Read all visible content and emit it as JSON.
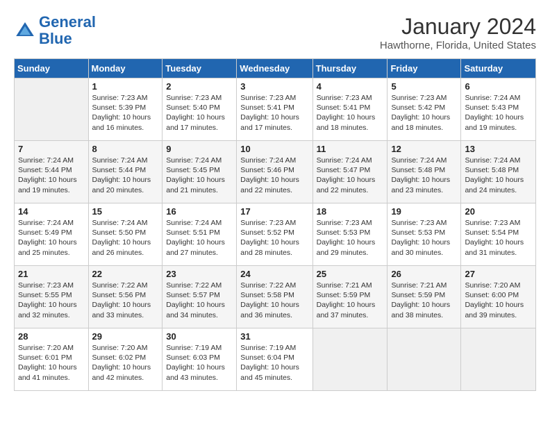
{
  "logo": {
    "line1": "General",
    "line2": "Blue"
  },
  "title": "January 2024",
  "subtitle": "Hawthorne, Florida, United States",
  "weekdays": [
    "Sunday",
    "Monday",
    "Tuesday",
    "Wednesday",
    "Thursday",
    "Friday",
    "Saturday"
  ],
  "weeks": [
    [
      {
        "num": "",
        "info": ""
      },
      {
        "num": "1",
        "info": "Sunrise: 7:23 AM\nSunset: 5:39 PM\nDaylight: 10 hours\nand 16 minutes."
      },
      {
        "num": "2",
        "info": "Sunrise: 7:23 AM\nSunset: 5:40 PM\nDaylight: 10 hours\nand 17 minutes."
      },
      {
        "num": "3",
        "info": "Sunrise: 7:23 AM\nSunset: 5:41 PM\nDaylight: 10 hours\nand 17 minutes."
      },
      {
        "num": "4",
        "info": "Sunrise: 7:23 AM\nSunset: 5:41 PM\nDaylight: 10 hours\nand 18 minutes."
      },
      {
        "num": "5",
        "info": "Sunrise: 7:23 AM\nSunset: 5:42 PM\nDaylight: 10 hours\nand 18 minutes."
      },
      {
        "num": "6",
        "info": "Sunrise: 7:24 AM\nSunset: 5:43 PM\nDaylight: 10 hours\nand 19 minutes."
      }
    ],
    [
      {
        "num": "7",
        "info": "Sunrise: 7:24 AM\nSunset: 5:44 PM\nDaylight: 10 hours\nand 19 minutes."
      },
      {
        "num": "8",
        "info": "Sunrise: 7:24 AM\nSunset: 5:44 PM\nDaylight: 10 hours\nand 20 minutes."
      },
      {
        "num": "9",
        "info": "Sunrise: 7:24 AM\nSunset: 5:45 PM\nDaylight: 10 hours\nand 21 minutes."
      },
      {
        "num": "10",
        "info": "Sunrise: 7:24 AM\nSunset: 5:46 PM\nDaylight: 10 hours\nand 22 minutes."
      },
      {
        "num": "11",
        "info": "Sunrise: 7:24 AM\nSunset: 5:47 PM\nDaylight: 10 hours\nand 22 minutes."
      },
      {
        "num": "12",
        "info": "Sunrise: 7:24 AM\nSunset: 5:48 PM\nDaylight: 10 hours\nand 23 minutes."
      },
      {
        "num": "13",
        "info": "Sunrise: 7:24 AM\nSunset: 5:48 PM\nDaylight: 10 hours\nand 24 minutes."
      }
    ],
    [
      {
        "num": "14",
        "info": "Sunrise: 7:24 AM\nSunset: 5:49 PM\nDaylight: 10 hours\nand 25 minutes."
      },
      {
        "num": "15",
        "info": "Sunrise: 7:24 AM\nSunset: 5:50 PM\nDaylight: 10 hours\nand 26 minutes."
      },
      {
        "num": "16",
        "info": "Sunrise: 7:24 AM\nSunset: 5:51 PM\nDaylight: 10 hours\nand 27 minutes."
      },
      {
        "num": "17",
        "info": "Sunrise: 7:23 AM\nSunset: 5:52 PM\nDaylight: 10 hours\nand 28 minutes."
      },
      {
        "num": "18",
        "info": "Sunrise: 7:23 AM\nSunset: 5:53 PM\nDaylight: 10 hours\nand 29 minutes."
      },
      {
        "num": "19",
        "info": "Sunrise: 7:23 AM\nSunset: 5:53 PM\nDaylight: 10 hours\nand 30 minutes."
      },
      {
        "num": "20",
        "info": "Sunrise: 7:23 AM\nSunset: 5:54 PM\nDaylight: 10 hours\nand 31 minutes."
      }
    ],
    [
      {
        "num": "21",
        "info": "Sunrise: 7:23 AM\nSunset: 5:55 PM\nDaylight: 10 hours\nand 32 minutes."
      },
      {
        "num": "22",
        "info": "Sunrise: 7:22 AM\nSunset: 5:56 PM\nDaylight: 10 hours\nand 33 minutes."
      },
      {
        "num": "23",
        "info": "Sunrise: 7:22 AM\nSunset: 5:57 PM\nDaylight: 10 hours\nand 34 minutes."
      },
      {
        "num": "24",
        "info": "Sunrise: 7:22 AM\nSunset: 5:58 PM\nDaylight: 10 hours\nand 36 minutes."
      },
      {
        "num": "25",
        "info": "Sunrise: 7:21 AM\nSunset: 5:59 PM\nDaylight: 10 hours\nand 37 minutes."
      },
      {
        "num": "26",
        "info": "Sunrise: 7:21 AM\nSunset: 5:59 PM\nDaylight: 10 hours\nand 38 minutes."
      },
      {
        "num": "27",
        "info": "Sunrise: 7:20 AM\nSunset: 6:00 PM\nDaylight: 10 hours\nand 39 minutes."
      }
    ],
    [
      {
        "num": "28",
        "info": "Sunrise: 7:20 AM\nSunset: 6:01 PM\nDaylight: 10 hours\nand 41 minutes."
      },
      {
        "num": "29",
        "info": "Sunrise: 7:20 AM\nSunset: 6:02 PM\nDaylight: 10 hours\nand 42 minutes."
      },
      {
        "num": "30",
        "info": "Sunrise: 7:19 AM\nSunset: 6:03 PM\nDaylight: 10 hours\nand 43 minutes."
      },
      {
        "num": "31",
        "info": "Sunrise: 7:19 AM\nSunset: 6:04 PM\nDaylight: 10 hours\nand 45 minutes."
      },
      {
        "num": "",
        "info": ""
      },
      {
        "num": "",
        "info": ""
      },
      {
        "num": "",
        "info": ""
      }
    ]
  ]
}
